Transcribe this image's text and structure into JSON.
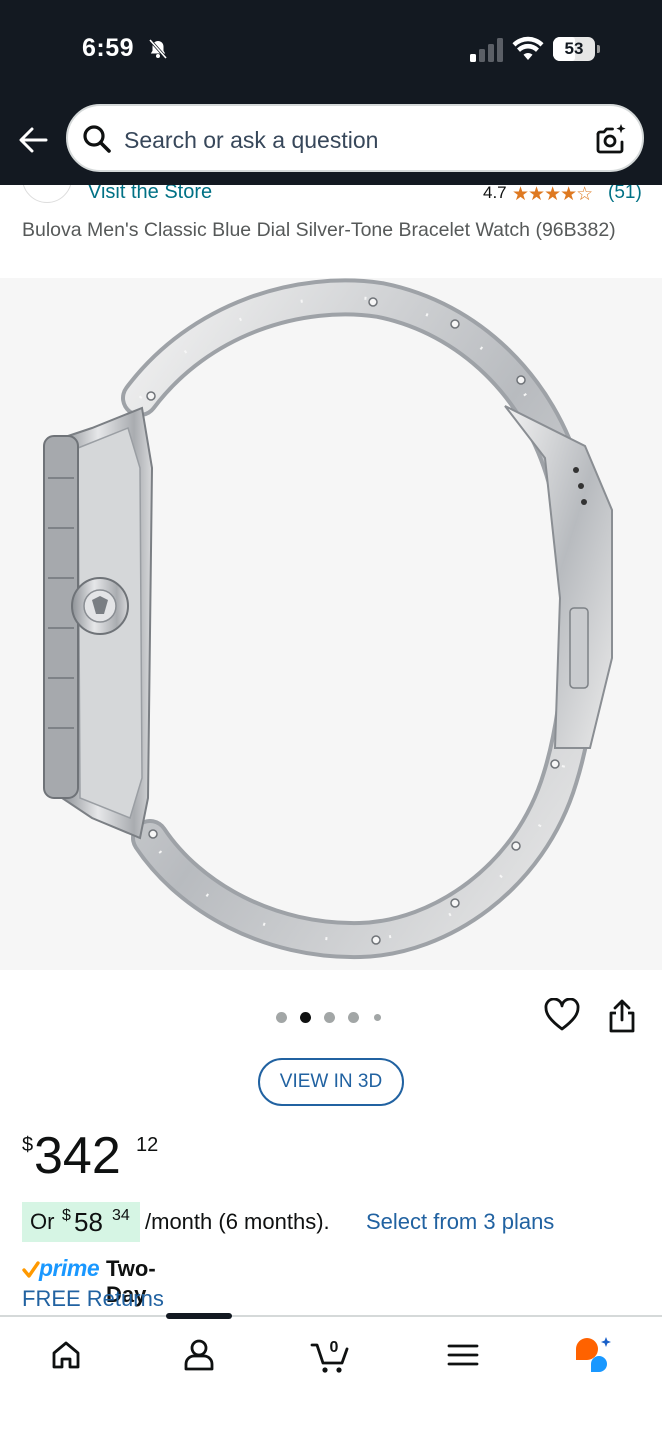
{
  "status_bar": {
    "time": "6:59",
    "battery": "53",
    "battery_fraction": 0.53
  },
  "search": {
    "placeholder": "Search or ask a question"
  },
  "store": {
    "link_label": "Visit the Store",
    "rating": "4.7",
    "stars": "★★★★☆",
    "rating_count": "(51)"
  },
  "product": {
    "title": "Bulova Men's Classic Blue Dial Silver-Tone Bracelet Watch (96B382)"
  },
  "gallery": {
    "image_count": 5,
    "active_index": 1
  },
  "buttons": {
    "view_3d": "VIEW IN 3D"
  },
  "price": {
    "symbol": "$",
    "whole": "342",
    "fraction": "12"
  },
  "installment": {
    "prefix": "Or",
    "symbol": "$",
    "whole": "58",
    "fraction": "34",
    "suffix": "/month (6 months).",
    "link": "Select from 3 plans"
  },
  "delivery": {
    "prime": "prime",
    "speed": "Two-Day",
    "returns": "FREE Returns"
  },
  "nav": {
    "items": [
      "home-icon",
      "account-icon",
      "cart-icon",
      "menu-icon",
      "rufus-icon"
    ],
    "cart_count": "0"
  },
  "colors": {
    "header": "#131921",
    "link": "#007185",
    "star": "#de7921",
    "prime": "#1a98ff",
    "accent": "#ff6200"
  }
}
